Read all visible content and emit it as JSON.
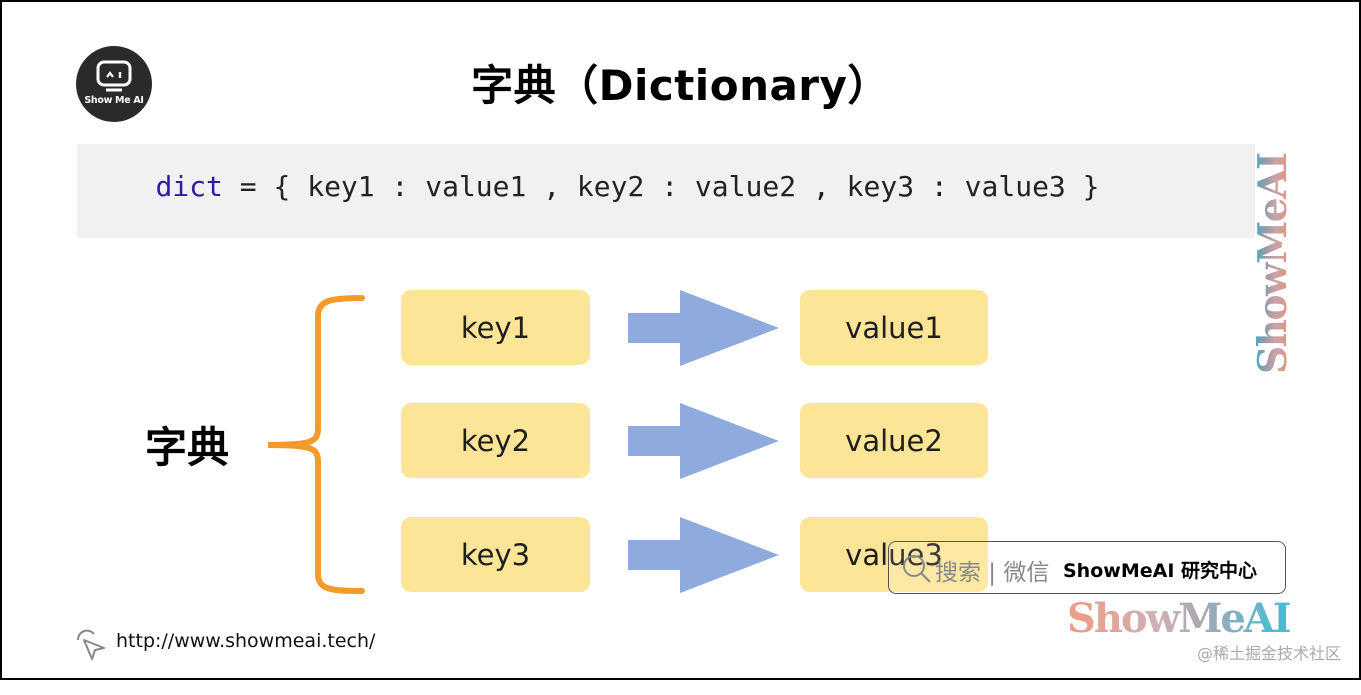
{
  "title": "字典（Dictionary）",
  "logo": {
    "text": "Show Me AI",
    "icon": "robot-monitor-icon"
  },
  "code": {
    "keyword": "dict",
    "rest": " = { key1 : value1 , key2 : value2 , key3 : value3 }"
  },
  "diagram": {
    "group_label": "字典",
    "pairs": [
      {
        "key": "key1",
        "value": "value1"
      },
      {
        "key": "key2",
        "value": "value2"
      },
      {
        "key": "key3",
        "value": "value3"
      }
    ]
  },
  "watermark": {
    "vertical_text": "ShowMeAI",
    "search_hint": "搜索 | 微信",
    "search_brand": "ShowMeAI 研究中心",
    "search_brand_bg": "ShowMeAI"
  },
  "footer": {
    "url": "http://www.showmeai.tech/",
    "credit": "@稀土掘金技术社区"
  },
  "colors": {
    "box_fill": "#fde598",
    "arrow_fill": "#8faadc",
    "brace_stroke": "#f39a2b",
    "code_bg": "#f1f1f1",
    "code_keyword": "#2b1ea0"
  }
}
